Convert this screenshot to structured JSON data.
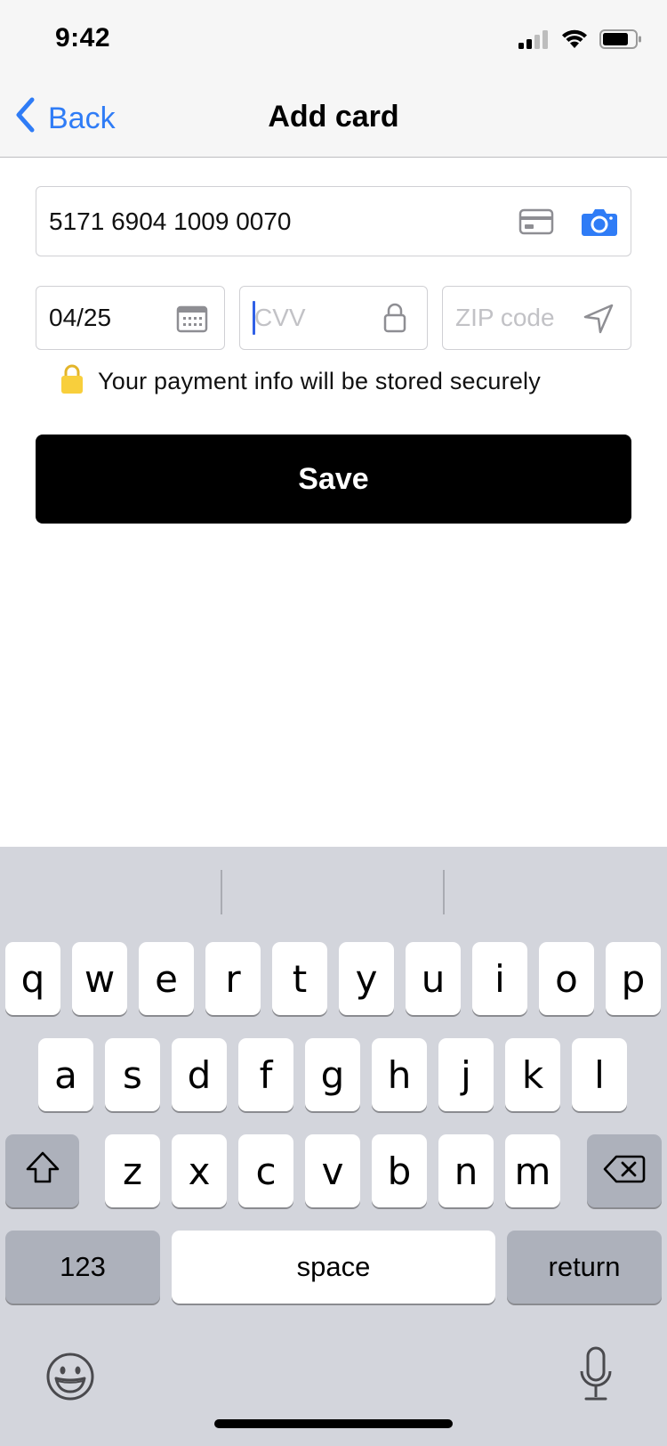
{
  "status_bar": {
    "time": "9:42"
  },
  "nav": {
    "back_label": "Back",
    "title": "Add card"
  },
  "form": {
    "card_number": {
      "value": "5171 6904 1009 0070",
      "icons": [
        "credit-card-icon",
        "camera-icon"
      ]
    },
    "expiry": {
      "value": "04/25",
      "icon": "calendar-icon"
    },
    "cvv": {
      "value": "",
      "placeholder": "CVV",
      "icon": "lock-icon",
      "focused": true
    },
    "zip": {
      "value": "",
      "placeholder": "ZIP code",
      "icon": "location-arrow-icon"
    },
    "secure_note": "Your payment info will be stored securely",
    "save_label": "Save"
  },
  "keyboard": {
    "rows": [
      [
        "q",
        "w",
        "e",
        "r",
        "t",
        "y",
        "u",
        "i",
        "o",
        "p"
      ],
      [
        "a",
        "s",
        "d",
        "f",
        "g",
        "h",
        "j",
        "k",
        "l"
      ],
      [
        "z",
        "x",
        "c",
        "v",
        "b",
        "n",
        "m"
      ]
    ],
    "numbers_label": "123",
    "space_label": "space",
    "return_label": "return",
    "icons": [
      "shift-icon",
      "delete-icon",
      "emoji-icon",
      "microphone-icon"
    ]
  },
  "colors": {
    "accent": "#2f7cf6",
    "save_button": "#000000",
    "lock_badge": "#f8cf3c",
    "keyboard_bg": "#d3d5dc",
    "special_key": "#adb1bb"
  }
}
